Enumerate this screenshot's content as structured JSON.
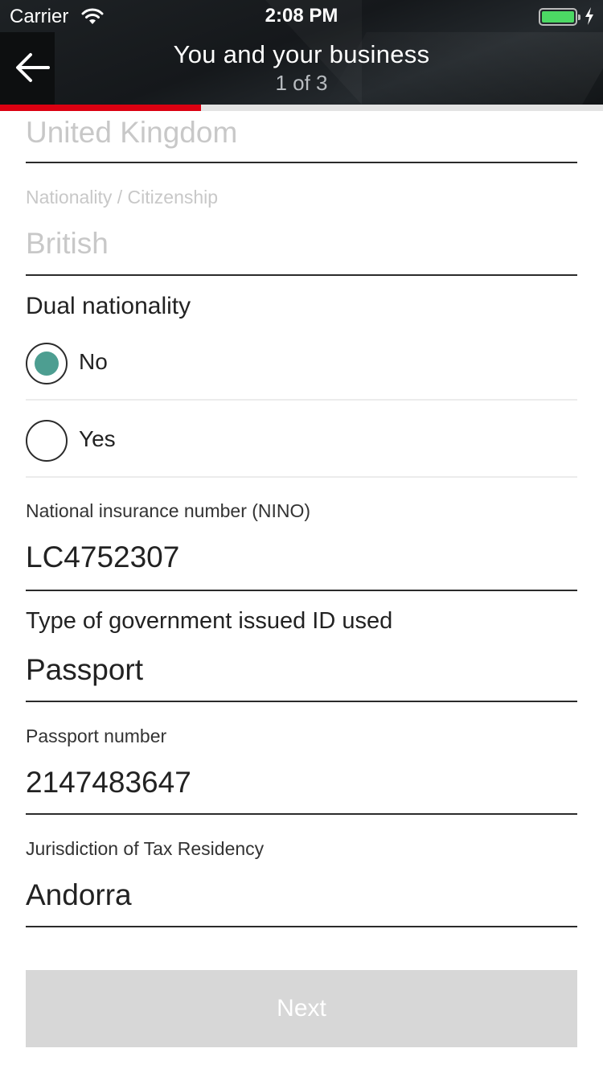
{
  "status_bar": {
    "carrier": "Carrier",
    "time": "2:08 PM"
  },
  "header": {
    "title": "You and your business",
    "step": "1 of 3",
    "progress_fraction": 0.333,
    "accent_color": "#db0011"
  },
  "form": {
    "country": {
      "value": "United Kingdom"
    },
    "nationality": {
      "label": "Nationality / Citizenship",
      "value": "British"
    },
    "dual_nationality": {
      "question": "Dual nationality",
      "options": [
        {
          "label": "No",
          "selected": true
        },
        {
          "label": "Yes",
          "selected": false
        }
      ],
      "selected_color": "#4d9e91"
    },
    "nino": {
      "label": "National insurance number (NINO)",
      "value": "LC4752307"
    },
    "id_type": {
      "label": "Type of government issued ID used",
      "value": "Passport"
    },
    "passport": {
      "label": "Passport number",
      "value": "2147483647"
    },
    "tax_residency": {
      "label": "Jurisdiction of Tax Residency",
      "value": "Andorra"
    }
  },
  "next_button": {
    "label": "Next",
    "enabled": false
  }
}
